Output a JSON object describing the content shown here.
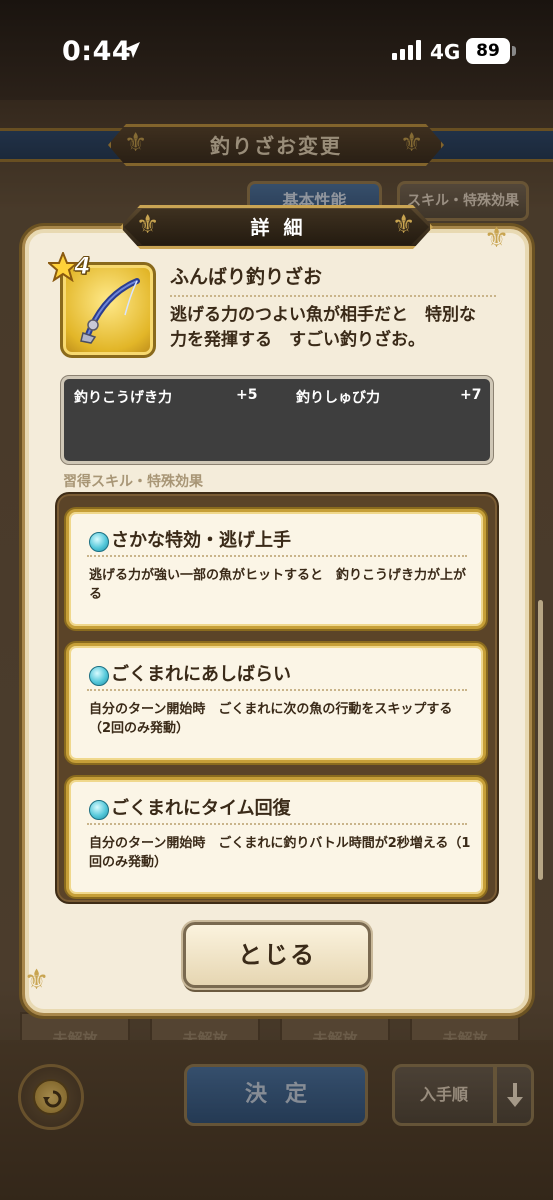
{
  "status_bar": {
    "time": "0:44",
    "network": "4G",
    "battery": "89"
  },
  "background": {
    "title": "釣りざお変更",
    "tab_basic": "基本性能",
    "tab_skills": "スキル・特殊効果",
    "slot_label": "未解放",
    "decide_label": "決定",
    "sort_label": "入手順"
  },
  "dialog": {
    "title": "詳細",
    "item": {
      "rarity": "4",
      "name": "ふんばり釣りざお",
      "description": "逃げる力のつよい魚が相手だと　特別な力を発揮する　すごい釣りざお。",
      "stats": [
        {
          "label": "釣りこうげき力",
          "value": "+5"
        },
        {
          "label": "釣りしゅび力",
          "value": "+7"
        }
      ]
    },
    "skills_caption": "習得スキル・特殊効果",
    "skills": [
      {
        "title": "さかな特効・逃げ上手",
        "description": "逃げる力が強い一部の魚がヒットすると　釣りこうげき力が上がる"
      },
      {
        "title": "ごくまれにあしばらい",
        "description": "自分のターン開始時　ごくまれに次の魚の行動をスキップする（2回のみ発動）"
      },
      {
        "title": "ごくまれにタイム回復",
        "description": "自分のターン開始時　ごくまれに釣りバトル時間が2秒増える（1回のみ発動）"
      }
    ],
    "close_label": "とじる"
  },
  "colors": {
    "dialog_bg": "#f4ecda",
    "gold_border": "#c69f38",
    "blue_button": "#2a4d78",
    "skill_orb": "#55c8da"
  },
  "icons": [
    "location-arrow-icon",
    "signal-icon",
    "battery-icon",
    "star-icon",
    "fishing-rod-icon",
    "skill-orb-icon",
    "back-arrow-icon",
    "down-arrow-icon",
    "fleur-ornament-icon"
  ]
}
